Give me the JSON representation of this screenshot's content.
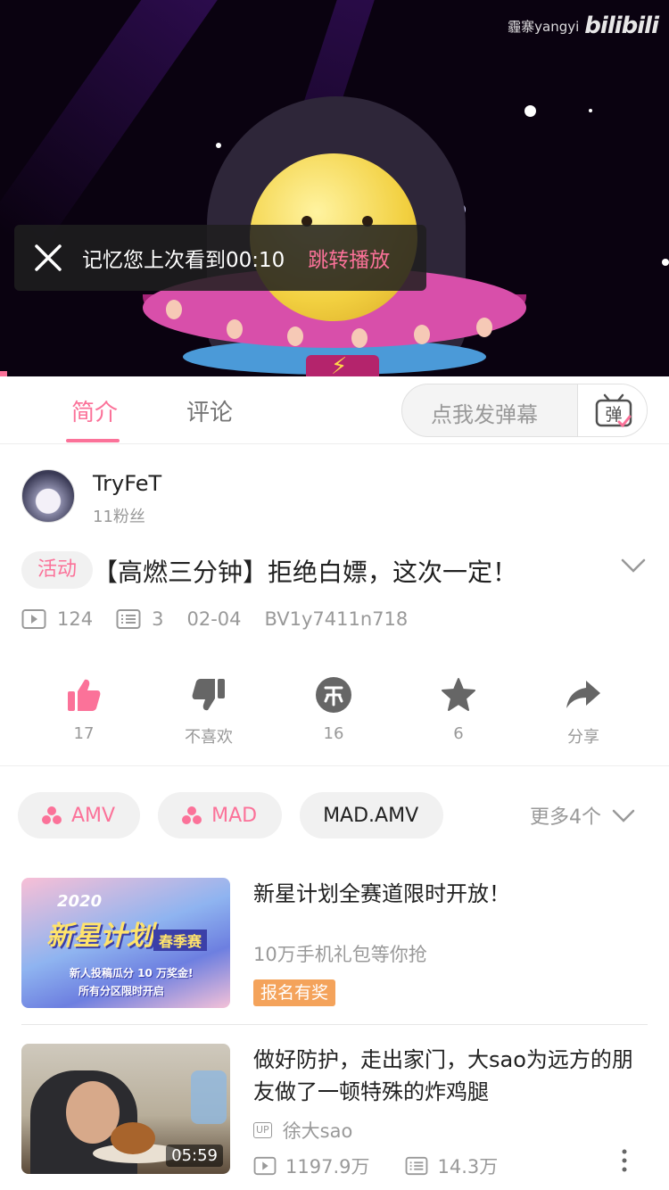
{
  "player": {
    "watermark_user": "霾寨yangyi",
    "watermark_logo": "bilibili",
    "resume_text": "记忆您上次看到00:10",
    "resume_action": "跳转播放"
  },
  "tabs": [
    {
      "label": "简介",
      "active": true
    },
    {
      "label": "评论",
      "active": false
    }
  ],
  "danmaku": {
    "placeholder": "点我发弹幕",
    "button_icon": "danmaku-tv-icon",
    "button_glyph": "弹"
  },
  "uploader": {
    "name": "TryFeT",
    "fans": "11粉丝"
  },
  "video": {
    "tag": "活动",
    "title": "【高燃三分钟】拒绝白嫖，这次一定！",
    "views": "124",
    "danmaku_count": "3",
    "date": "02-04",
    "bvid": "BV1y7411n718"
  },
  "actions": [
    {
      "name": "like",
      "icon": "thumbs-up-icon",
      "label": "17",
      "active": true
    },
    {
      "name": "dislike",
      "icon": "thumbs-down-icon",
      "label": "不喜欢",
      "active": false
    },
    {
      "name": "coin",
      "icon": "coin-icon",
      "label": "16",
      "active": false
    },
    {
      "name": "favorite",
      "icon": "star-icon",
      "label": "6",
      "active": false
    },
    {
      "name": "share",
      "icon": "share-icon",
      "label": "分享",
      "active": false
    }
  ],
  "tags": [
    {
      "label": "AMV",
      "style": "channel"
    },
    {
      "label": "MAD",
      "style": "channel"
    },
    {
      "label": "MAD.AMV",
      "style": "plain"
    }
  ],
  "more_tags": "更多4个",
  "recommendations": [
    {
      "title": "新星计划全赛道限时开放！",
      "desc": "10万手机礼包等你抢",
      "badge": "报名有奖",
      "thumb": {
        "year": "2020",
        "headline": "新星计划",
        "season": "春季赛",
        "line1": "新人投稿瓜分 10 万奖金!",
        "line2": "所有分区限时开启"
      }
    },
    {
      "title": "做好防护，走出家门，大sao为远方的朋友做了一顿特殊的炸鸡腿",
      "author_badge": "UP",
      "author": "徐大sao",
      "views": "1197.9万",
      "danmaku": "14.3万",
      "duration": "05:59"
    }
  ],
  "colors": {
    "accent": "#fb7299",
    "secondary_text": "#999999",
    "badge_orange": "#f4a35b"
  }
}
